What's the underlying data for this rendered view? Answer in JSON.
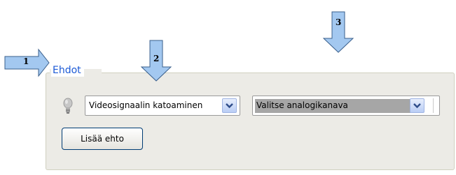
{
  "groupbox": {
    "legend": "Ehdot"
  },
  "conditions": {
    "type_select_value": "Videosignaalin katoaminen",
    "channel_select_value": "Valitse analogikanava",
    "add_button_label": "Lisää ehto"
  },
  "callouts": [
    {
      "number": "1"
    },
    {
      "number": "2"
    },
    {
      "number": "3"
    }
  ],
  "colors": {
    "legend_text": "#1c5ad6",
    "groupbox_bg": "#ecebe6",
    "callout_fill": "#a3c8f0",
    "callout_stroke": "#3a5f8c"
  }
}
